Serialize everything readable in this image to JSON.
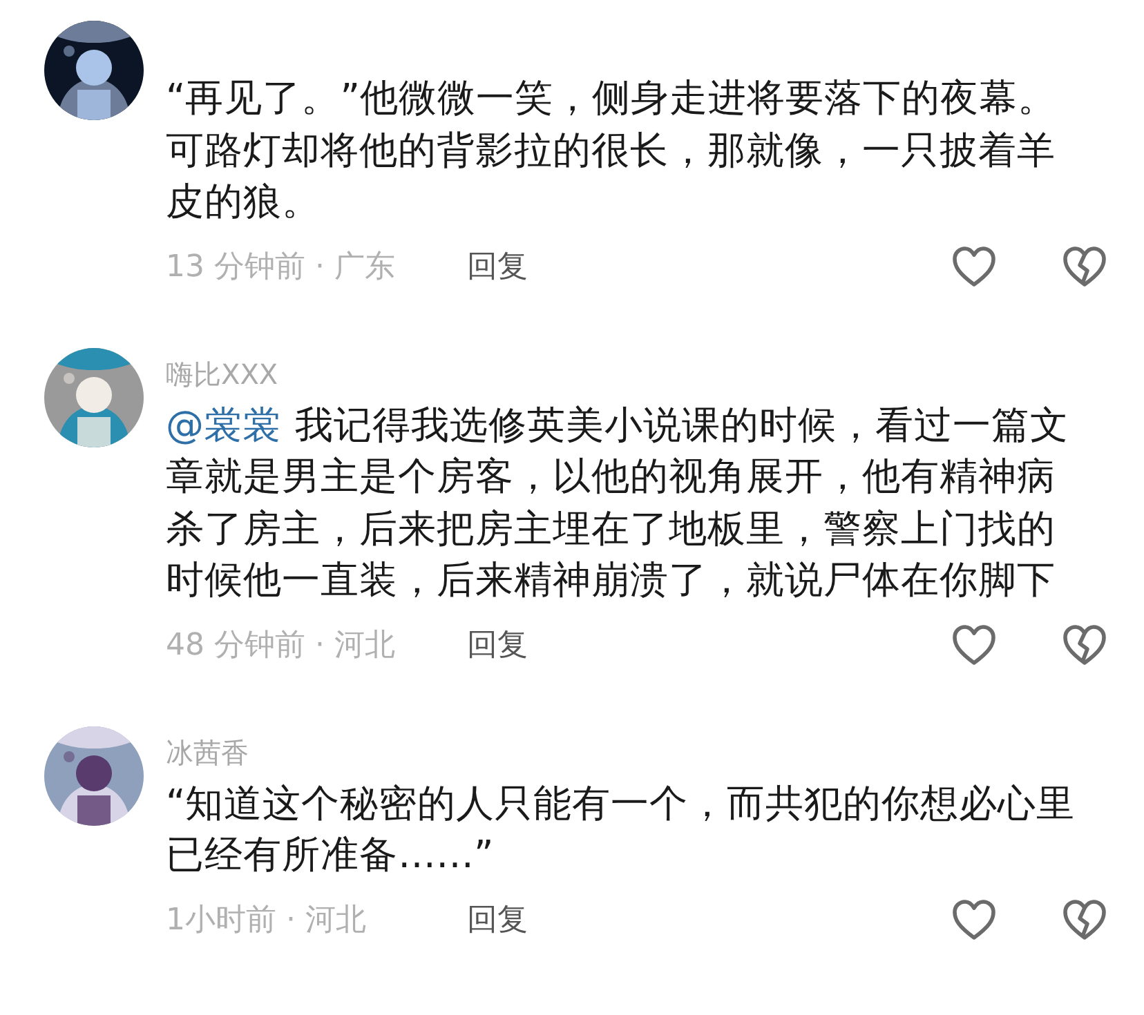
{
  "comments": [
    {
      "text": "“再见了。”他微微一笑，侧身走进将要落下的夜幕。可路灯却将他的背影拉的很长，那就像，一只披着羊皮的狼。",
      "time_location": "13 分钟前 · 广东",
      "reply": "回复"
    },
    {
      "username": "嗨比XXX",
      "mention": "@裳裳",
      "text": "我记得我选修英美小说课的时候，看过一篇文章就是男主是个房客，以他的视角展开，他有精神病杀了房主，后来把房主埋在了地板里，警察上门找的时候他一直装，后来精神崩溃了，就说尸体在你脚下",
      "time_location": "48 分钟前 · 河北",
      "reply": "回复"
    },
    {
      "username": "冰茜香",
      "text": "“知道这个秘密的人只能有一个，而共犯的你想必心里已经有所准备……”",
      "time_location": "1小时前 · 河北",
      "reply": "回复"
    }
  ]
}
